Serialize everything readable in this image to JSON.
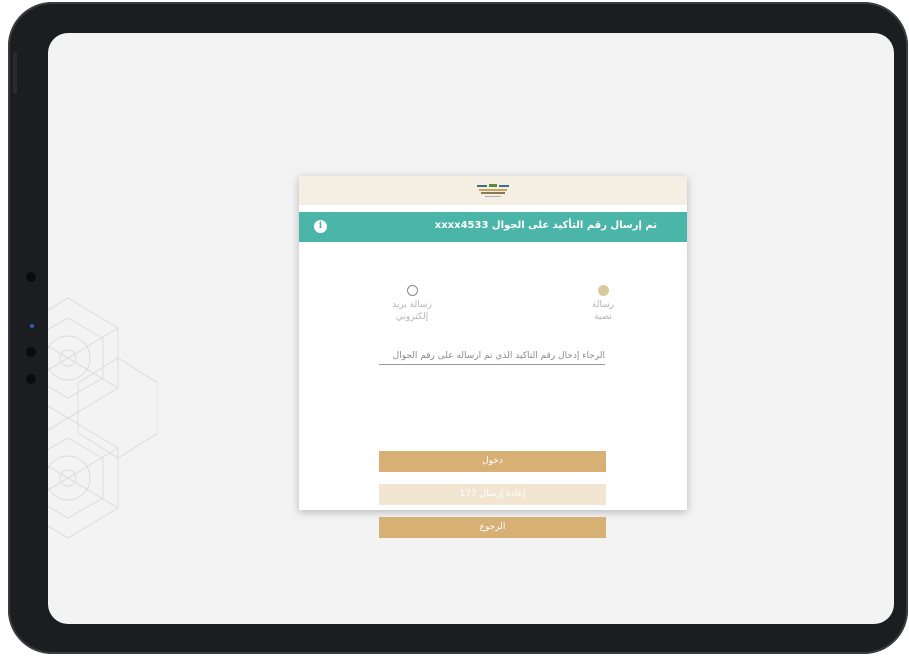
{
  "modal": {
    "banner_text": "تم إرسال رقم التأكيد على الجوال xxxx4533",
    "options": [
      {
        "label_line1": "رسالة",
        "label_line2": "نصية",
        "selected": true
      },
      {
        "label_line1": "رسالة بريد",
        "label_line2": "إلكتروني",
        "selected": false
      }
    ],
    "code_input": {
      "value": "",
      "placeholder": "الرجاء إدخال رقم التأكيد الذي تم ارساله على رقم الجوال"
    },
    "login_label": "دخول",
    "resend_label": "إعادة إرسال 177",
    "back_label": "الرجوع"
  },
  "colors": {
    "banner": "#4cb5a9",
    "primary_button": "#d6b075",
    "disabled_button": "#f2e5d1",
    "header": "#f4efe2"
  },
  "icons": [
    "info-icon",
    "logo-icon"
  ]
}
